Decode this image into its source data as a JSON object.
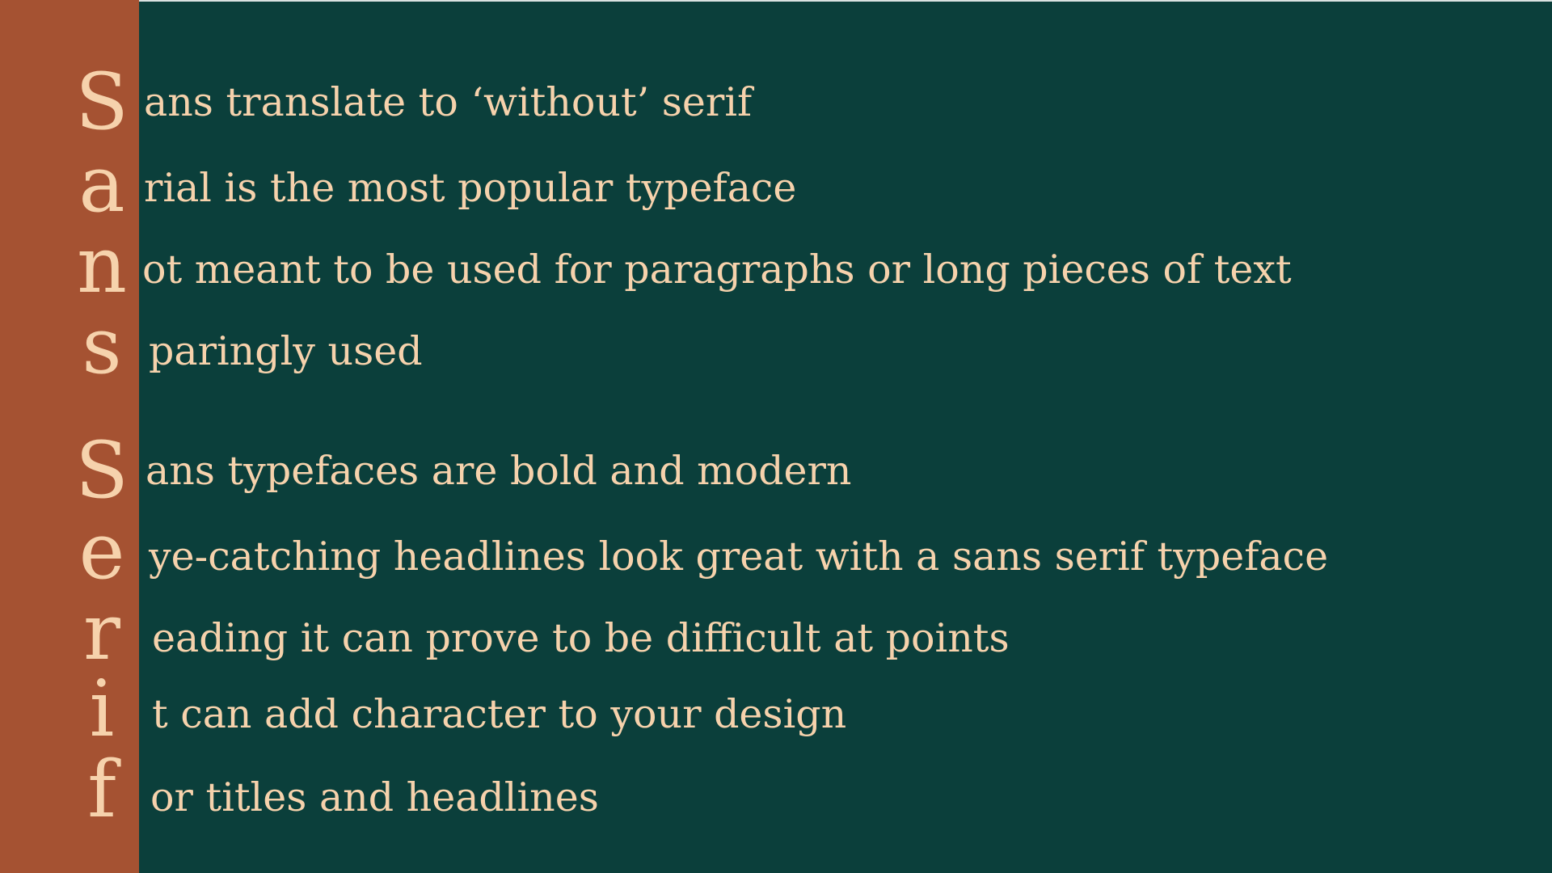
{
  "colors": {
    "background": "#0b3f3b",
    "accent_bar": "#a55232",
    "text": "#f6d2ac"
  },
  "lines": [
    {
      "initial": "S",
      "text": "ans translate to ‘without’ serif"
    },
    {
      "initial": "a",
      "text": "rial is the most popular typeface"
    },
    {
      "initial": "n",
      "text": "ot meant to be used for paragraphs or long pieces of text"
    },
    {
      "initial": "s",
      "text": "paringly used"
    },
    {
      "initial": "S",
      "text": "ans typefaces are bold and modern"
    },
    {
      "initial": "e",
      "text": "ye-catching headlines look great with a sans serif typeface"
    },
    {
      "initial": "r",
      "text": "eading it can prove to be difficult at points"
    },
    {
      "initial": "i",
      "text": "t can add character to your design"
    },
    {
      "initial": "f",
      "text": "or titles and headlines"
    }
  ]
}
